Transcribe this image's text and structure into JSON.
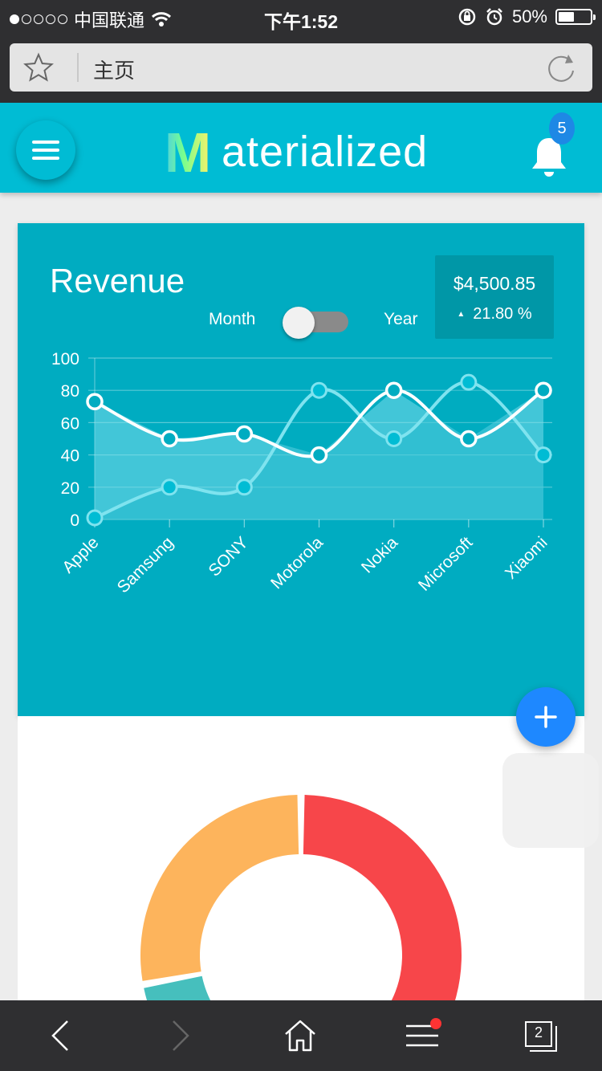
{
  "status_bar": {
    "carrier": "中国联通",
    "time": "下午1:52",
    "battery": "50%",
    "battery_level": 0.5,
    "signal_bars": 1
  },
  "browser": {
    "url_title": "主页",
    "tabs_count": "2"
  },
  "app": {
    "brand_letter": "M",
    "brand_rest": "aterialized",
    "notification_count": "5",
    "colors": {
      "header": "#00bcd4",
      "card": "#00acc1",
      "fab": "#1e88ff",
      "badge": "#1e88e5"
    }
  },
  "revenue": {
    "title": "Revenue",
    "toggle_left": "Month",
    "toggle_right": "Year",
    "amount": "$4,500.85",
    "change": "21.80 %"
  },
  "chart_data": [
    {
      "type": "line",
      "title": "Revenue",
      "categories": [
        "Apple",
        "Samsung",
        "SONY",
        "Motorola",
        "Nokia",
        "Microsoft",
        "Xiaomi"
      ],
      "series": [
        {
          "values": [
            73,
            50,
            53,
            40,
            80,
            50,
            80
          ],
          "style": "white-line-filled"
        },
        {
          "values": [
            1,
            20,
            20,
            80,
            50,
            85,
            40
          ],
          "style": "cyan-line"
        }
      ],
      "ylim": [
        0,
        100
      ],
      "yticks": [
        "0",
        "20",
        "40",
        "60",
        "80",
        "100"
      ],
      "grid": true
    },
    {
      "type": "pie",
      "variant": "donut",
      "values": [
        50,
        12,
        24
      ],
      "colors": [
        "#f7464a",
        "#46bfbd",
        "#fdb45c"
      ]
    }
  ]
}
